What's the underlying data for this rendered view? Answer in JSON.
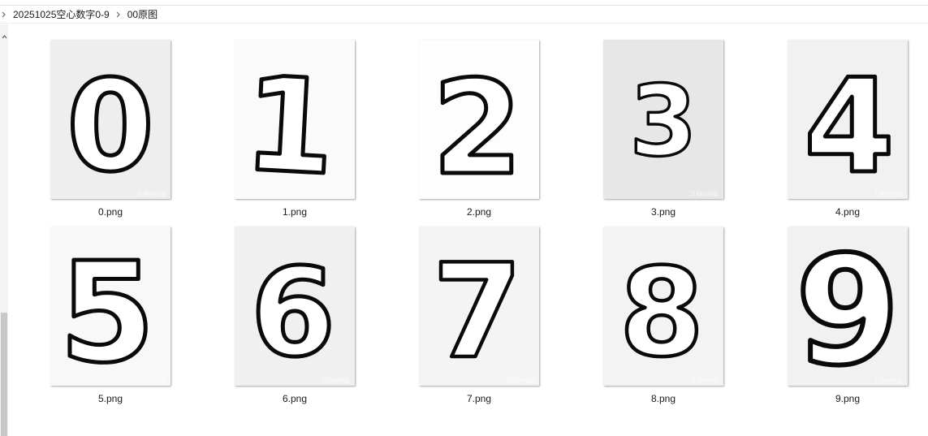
{
  "breadcrumb": {
    "items": [
      "20251025空心数字0-9",
      "00原图"
    ],
    "chevron_icon": "chevron-right-icon"
  },
  "files": [
    {
      "name": "0.png",
      "glyph": "0",
      "bg": "#eeeeee"
    },
    {
      "name": "1.png",
      "glyph": "1",
      "bg": "#fafafa"
    },
    {
      "name": "2.png",
      "glyph": "2",
      "bg": "#fdfdfd"
    },
    {
      "name": "3.png",
      "glyph": "3",
      "bg": "#e7e7e7"
    },
    {
      "name": "4.png",
      "glyph": "4",
      "bg": "#f1f1f1"
    },
    {
      "name": "5.png",
      "glyph": "5",
      "bg": "#f8f8f8"
    },
    {
      "name": "6.png",
      "glyph": "6",
      "bg": "#f0f0f0"
    },
    {
      "name": "7.png",
      "glyph": "7",
      "bg": "#f4f4f4"
    },
    {
      "name": "8.png",
      "glyph": "8",
      "bg": "#f3f3f3"
    },
    {
      "name": "9.png",
      "glyph": "9",
      "bg": "#f1f1f1"
    }
  ],
  "watermark": "万相AI作画"
}
